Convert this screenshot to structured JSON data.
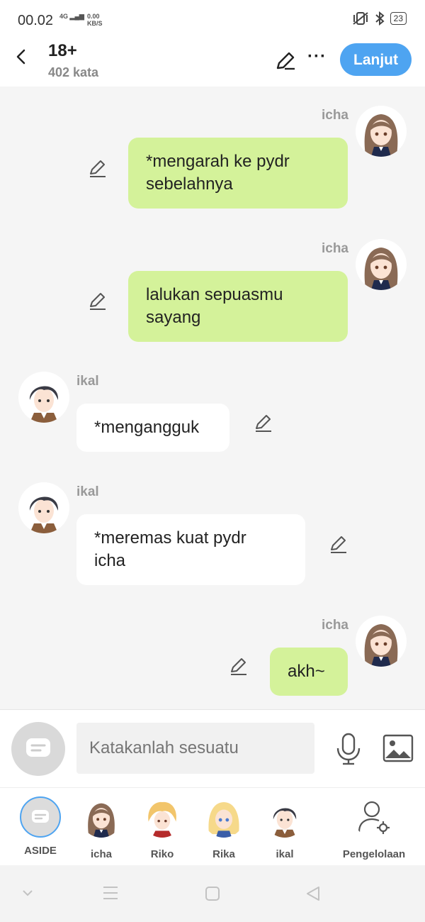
{
  "status_bar": {
    "time": "00.02",
    "network": "4G",
    "speed_value": "0.00",
    "speed_unit": "KB/S",
    "battery": "23"
  },
  "header": {
    "title": "18+",
    "word_count": "402 kata",
    "next_label": "Lanjut"
  },
  "messages": [
    {
      "sender": "icha",
      "text_line1": "*mengarah ke pydr",
      "text_line2": "sebelahnya"
    },
    {
      "sender": "icha",
      "text_line1": "lalukan sepuasmu",
      "text_line2": "sayang"
    },
    {
      "sender": "ikal",
      "text_line1": "*mengangguk"
    },
    {
      "sender": "ikal",
      "text_line1": "*meremas kuat pydr",
      "text_line2": "icha"
    },
    {
      "sender": "icha",
      "text_line1": "akh~"
    }
  ],
  "input": {
    "placeholder": "Katakanlah sesuatu"
  },
  "characters": [
    {
      "label": "ASIDE"
    },
    {
      "label": "icha"
    },
    {
      "label": "Riko"
    },
    {
      "label": "Rika"
    },
    {
      "label": "ikal"
    },
    {
      "label": "Pengelolaan"
    }
  ],
  "colors": {
    "accent": "#4ea4f1",
    "own_bubble": "#d4f29a",
    "other_bubble": "#ffffff",
    "background": "#f5f5f5"
  },
  "icons": [
    "back-icon",
    "edit-icon",
    "more-icon",
    "mic-icon",
    "image-icon",
    "chat-icon",
    "manage-icon"
  ]
}
